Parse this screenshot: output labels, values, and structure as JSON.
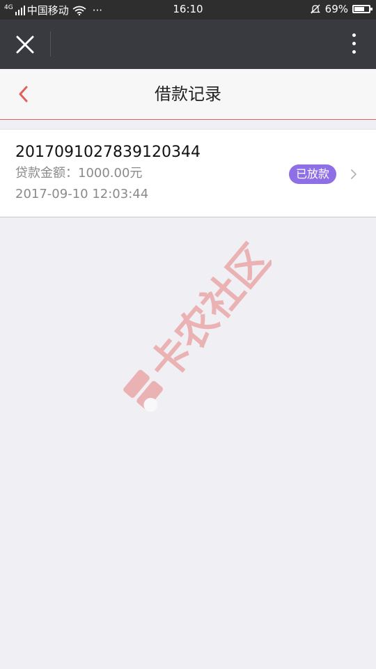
{
  "status_bar": {
    "network": "4G",
    "carrier": "中国移动",
    "more": "···",
    "time": "16:10",
    "battery": "69%",
    "battery_fraction": 0.69
  },
  "top_bar": {
    "close_icon": "close-icon",
    "more_icon": "more-vertical-icon"
  },
  "header": {
    "title": "借款记录",
    "back_icon": "chevron-left-icon",
    "accent_color": "#e0605f"
  },
  "records": [
    {
      "id": "20170910278391203​44",
      "amount_label": "贷款金额：",
      "amount": "1000.00元",
      "date": "2017-09-10 12:03:44",
      "status": "已放款",
      "status_color": "#8f6fe6"
    }
  ],
  "watermark": {
    "text": "卡农社区",
    "color": "#e98a8a"
  }
}
